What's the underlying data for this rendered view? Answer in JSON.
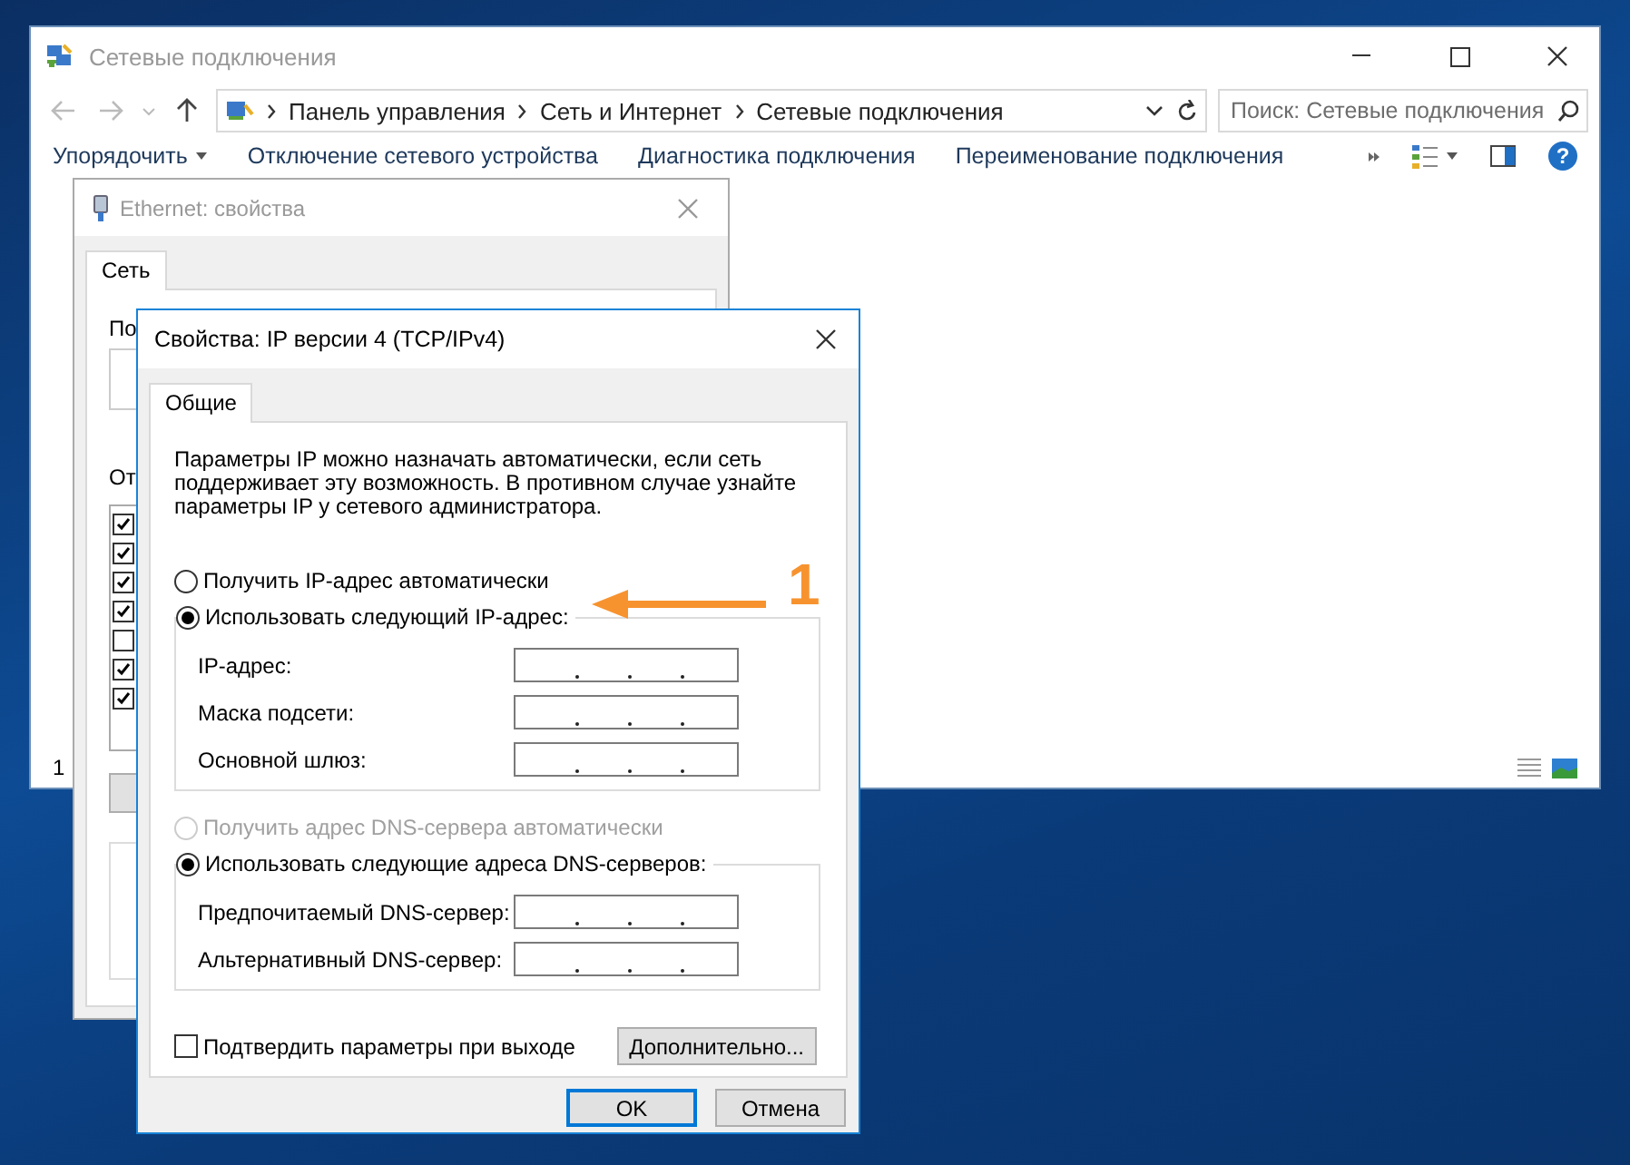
{
  "explorer": {
    "title": "Сетевые подключения",
    "breadcrumbs": [
      "Панель управления",
      "Сеть и Интернет",
      "Сетевые подключения"
    ],
    "search_placeholder": "Поиск: Сетевые подключения",
    "toolbar": [
      {
        "label": "Упорядочить",
        "dropdown": true
      },
      {
        "label": "Отключение сетевого устройства",
        "dropdown": false
      },
      {
        "label": "Диагностика подключения",
        "dropdown": false
      },
      {
        "label": "Переименование подключения",
        "dropdown": false
      }
    ],
    "help": "?",
    "status_text": "1"
  },
  "ethernet_window": {
    "title": "Ethernet: свойства",
    "tabs": [
      {
        "label": "Сеть",
        "selected": true
      }
    ],
    "connect_label": "По",
    "components_label": "От",
    "components": [
      {
        "checked": true
      },
      {
        "checked": true
      },
      {
        "checked": true
      },
      {
        "checked": true
      },
      {
        "checked": false
      },
      {
        "checked": true
      },
      {
        "checked": true
      }
    ]
  },
  "ipv4_dialog": {
    "title": "Свойства: IP версии 4 (TCP/IPv4)",
    "tabs": [
      {
        "label": "Общие",
        "selected": true
      }
    ],
    "description": "Параметры IP можно назначать автоматически, если сеть поддерживает эту возможность. В противном случае узнайте параметры IP у сетевого администратора.",
    "ip_options": [
      {
        "label": "Получить IP-адрес автоматически",
        "selected": false,
        "disabled": false
      },
      {
        "label": "Использовать следующий IP-адрес:",
        "selected": true,
        "disabled": false
      }
    ],
    "ip_fields": [
      {
        "label": "IP-адрес:"
      },
      {
        "label": "Маска подсети:"
      },
      {
        "label": "Основной шлюз:"
      }
    ],
    "dns_options": [
      {
        "label": "Получить адрес DNS-сервера автоматически",
        "selected": false,
        "disabled": true
      },
      {
        "label": "Использовать следующие адреса DNS-серверов:",
        "selected": true,
        "disabled": false
      }
    ],
    "dns_fields": [
      {
        "label": "Предпочитаемый DNS-сервер:"
      },
      {
        "label": "Альтернативный DNS-сервер:"
      }
    ],
    "validate_checkbox": {
      "label": "Подтвердить параметры при выходе",
      "checked": false
    },
    "advanced_button": "Дополнительно...",
    "buttons": [
      {
        "label": "OK",
        "default": true
      },
      {
        "label": "Отмена",
        "default": false
      }
    ]
  },
  "annotation": {
    "label": "1"
  }
}
